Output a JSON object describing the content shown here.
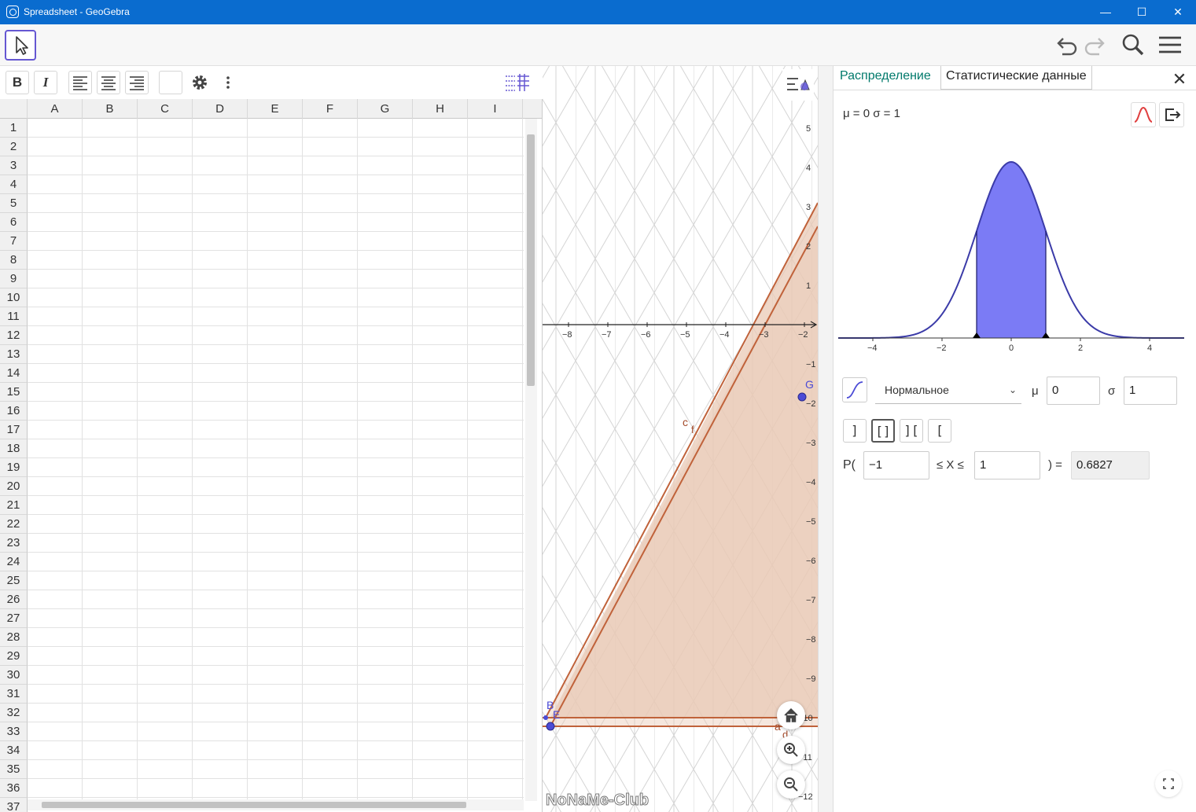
{
  "window": {
    "title": "Spreadsheet - GeoGebra",
    "minimize": "—",
    "maximize": "☐",
    "close": "✕"
  },
  "toolbar": {
    "icons": [
      "move-tool-icon",
      "undo-icon",
      "redo-icon",
      "search-icon",
      "menu-icon"
    ]
  },
  "stylebar": {
    "bold": "B",
    "italic": "I",
    "icons": [
      "align-left-icon",
      "align-center-icon",
      "align-right-icon",
      "background-color-icon",
      "settings-gear-icon",
      "more-vertical-icon",
      "grid-toggle-icon"
    ]
  },
  "spreadsheet": {
    "columns": [
      "A",
      "B",
      "C",
      "D",
      "E",
      "F",
      "G",
      "H",
      "I"
    ],
    "rows": [
      "1",
      "2",
      "3",
      "4",
      "5",
      "6",
      "7",
      "8",
      "9",
      "10",
      "11",
      "12",
      "13",
      "14",
      "15",
      "16",
      "17",
      "18",
      "19",
      "20",
      "21",
      "22",
      "23",
      "24",
      "25",
      "26",
      "27",
      "28",
      "29",
      "30",
      "31",
      "32",
      "33",
      "34",
      "35",
      "36",
      "37"
    ]
  },
  "graphics": {
    "x_ticks": [
      "−8",
      "−7",
      "−6",
      "−5",
      "−4",
      "−3",
      "−2"
    ],
    "y_ticks": [
      "5",
      "4",
      "3",
      "2",
      "1",
      "−1",
      "−2",
      "−3",
      "−4",
      "−5",
      "−6",
      "−7",
      "−8",
      "−9",
      "−10",
      "−11",
      "−12"
    ],
    "labels": {
      "G": "G",
      "c": "c",
      "f": "f",
      "B": "B",
      "E": "E",
      "a": "a",
      "d": "d"
    },
    "watermark": "NoNaMe-Club",
    "colors": {
      "line": "#c0623a",
      "fill": "#e9c9b6",
      "point": "#4b4bd6",
      "grid": "#d0d0d0"
    }
  },
  "probability": {
    "tab_distribution": "Распределение",
    "tab_statistics": "Статистические данные",
    "close": "✕",
    "params_label": "μ = 0 σ = 1",
    "distribution_name": "Нормальное",
    "mu_label": "μ",
    "mu_value": "0",
    "sigma_label": "σ",
    "sigma_value": "1",
    "p_label": "P(",
    "between_label": "≤ X ≤",
    "equals_label": ") =",
    "lower_bound": "−1",
    "upper_bound": "1",
    "result": "0.6827",
    "interval_buttons": [
      "]",
      "[]",
      "][",
      "["
    ],
    "x_ticks": [
      "−4",
      "−2",
      "0",
      "2",
      "4"
    ],
    "chart_data": {
      "type": "area",
      "mean": 0,
      "sd": 1,
      "xlim": [
        -5,
        5
      ],
      "shaded_interval": [
        -1,
        1
      ],
      "curve_color": "#3b3ba8",
      "fill_color": "#7b7bf5"
    }
  }
}
